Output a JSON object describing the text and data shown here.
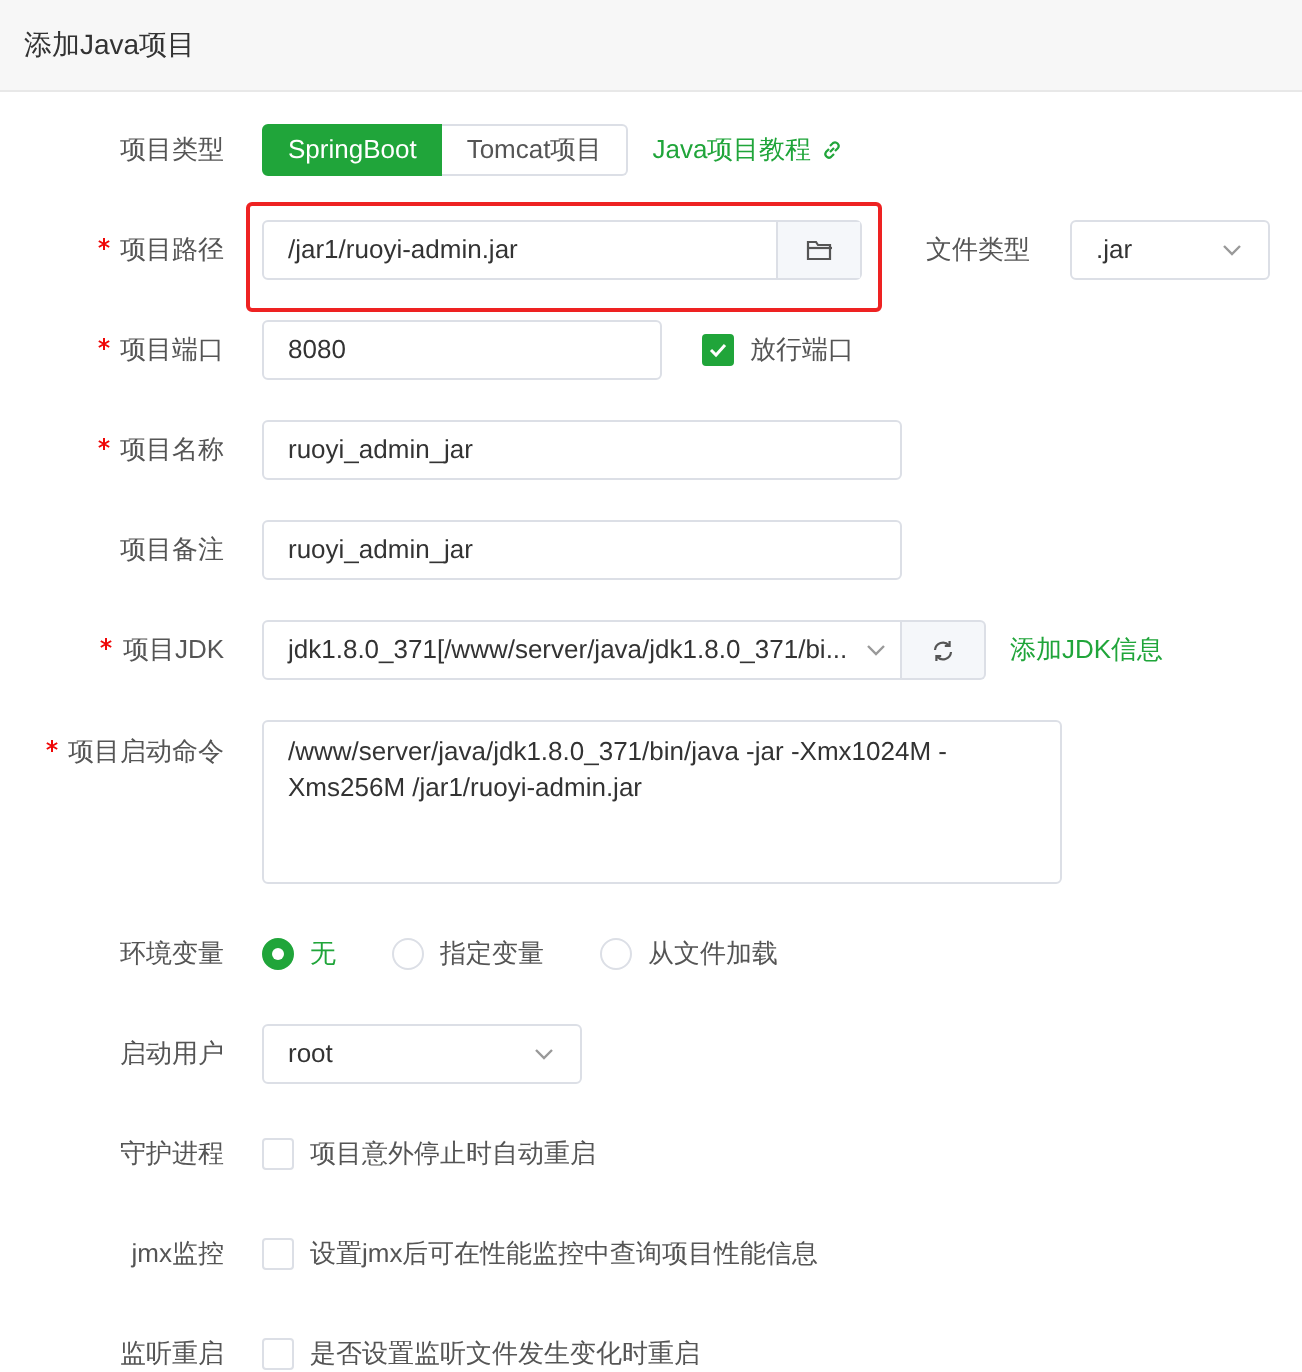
{
  "title": "添加Java项目",
  "rows": [
    {
      "kind": "segmented",
      "label": "项目类型",
      "required": false,
      "options": [
        {
          "label": "SpringBoot",
          "selected": true
        },
        {
          "label": "Tomcat项目",
          "selected": false
        }
      ],
      "link": "Java项目教程"
    },
    {
      "kind": "path",
      "label": "项目路径",
      "required": true,
      "value": "/jar1/ruoyi-admin.jar",
      "side_label": "文件类型",
      "side_value": ".jar"
    },
    {
      "kind": "port",
      "label": "项目端口",
      "required": true,
      "value": "8080",
      "checkbox_label": "放行端口",
      "checked": true
    },
    {
      "kind": "text",
      "label": "项目名称",
      "required": true,
      "value": "ruoyi_admin_jar"
    },
    {
      "kind": "text",
      "label": "项目备注",
      "required": false,
      "value": "ruoyi_admin_jar"
    },
    {
      "kind": "jdk",
      "label": "项目JDK",
      "required": true,
      "value": "jdk1.8.0_371[/www/server/java/jdk1.8.0_371/bi...",
      "link": "添加JDK信息"
    },
    {
      "kind": "textarea",
      "label": "项目启动命令",
      "required": true,
      "value": "/www/server/java/jdk1.8.0_371/bin/java -jar  -Xmx1024M -Xms256M /jar1/ruoyi-admin.jar"
    },
    {
      "kind": "radio",
      "label": "环境变量",
      "required": false,
      "options": [
        {
          "label": "无",
          "selected": true
        },
        {
          "label": "指定变量",
          "selected": false
        },
        {
          "label": "从文件加载",
          "selected": false
        }
      ]
    },
    {
      "kind": "select",
      "label": "启动用户",
      "required": false,
      "value": "root"
    },
    {
      "kind": "checkbox",
      "label": "守护进程",
      "required": false,
      "checkbox_label": "项目意外停止时自动重启",
      "checked": false
    },
    {
      "kind": "checkbox",
      "label": "jmx监控",
      "required": false,
      "checkbox_label": "设置jmx后可在性能监控中查询项目性能信息",
      "checked": false
    },
    {
      "kind": "checkbox",
      "label": "监听重启",
      "required": false,
      "checkbox_label": "是否设置监听文件发生变化时重启",
      "checked": false
    }
  ]
}
